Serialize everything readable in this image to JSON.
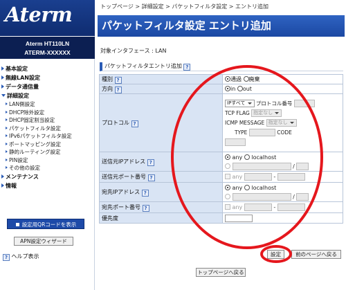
{
  "sidebar": {
    "logo": "Aterm",
    "model_line1": "Aterm   HT110LN",
    "model_line2": "ATERM-XXXXXX",
    "menu": [
      {
        "label": "基本設定",
        "kind": "top"
      },
      {
        "label": "無線LAN設定",
        "kind": "top"
      },
      {
        "label": "データ通信量",
        "kind": "top"
      },
      {
        "label": "詳細設定",
        "kind": "open"
      },
      {
        "label": "LAN側設定",
        "kind": "sub"
      },
      {
        "label": "DHCP除外設定",
        "kind": "sub"
      },
      {
        "label": "DHCP固定割当設定",
        "kind": "sub"
      },
      {
        "label": "パケットフィルタ設定",
        "kind": "sub"
      },
      {
        "label": "IPv6パケットフィルタ設定",
        "kind": "sub"
      },
      {
        "label": "ポートマッピング設定",
        "kind": "sub"
      },
      {
        "label": "静的ルーティング設定",
        "kind": "sub"
      },
      {
        "label": "PIN設定",
        "kind": "sub"
      },
      {
        "label": "その他の設定",
        "kind": "sub"
      },
      {
        "label": "メンテナンス",
        "kind": "top"
      },
      {
        "label": "情報",
        "kind": "top"
      }
    ],
    "qr_button": "設定用QRコードを表示",
    "apn_button": "APN設定ウィザード",
    "help_label": "ヘルプ表示"
  },
  "breadcrumb": "トップページ > 詳細設定 > パケットフィルタ設定 > エントリ追加",
  "page_title": "パケットフィルタ設定 エントリ追加",
  "interface_label": "対象インタフェース : LAN",
  "section_title": "パケットフィルタエントリ追加",
  "help_mark": "?",
  "form": {
    "type_label": "種別",
    "type_pass": "通過",
    "type_discard": "廃棄",
    "dir_label": "方向",
    "dir_in": "in",
    "dir_out": "out",
    "proto_label": "プロトコル",
    "proto_select": "IPすべて",
    "proto_num_label": "プロトコル番号",
    "tcp_flag_label": "TCP FLAG",
    "tcp_flag_select": "指定なし",
    "icmp_label": "ICMP MESSAGE",
    "icmp_select": "指定なし",
    "icmp_type_label": "TYPE",
    "icmp_code_label": "CODE",
    "src_ip_label": "送信元IPアドレス",
    "any": "any",
    "localhost": "localhost",
    "slash": "/",
    "src_port_label": "送信元ポート番号",
    "dash": "-",
    "dst_ip_label": "宛先IPアドレス",
    "dst_port_label": "宛先ポート番号",
    "priority_label": "優先度"
  },
  "buttons": {
    "save": "設定",
    "back": "前のページへ戻る",
    "top": "トップページへ戻る"
  },
  "colors": {
    "header_blue": "#1b48a3",
    "label_bg": "#d9e4f4",
    "annotation_red": "#e5171d"
  }
}
